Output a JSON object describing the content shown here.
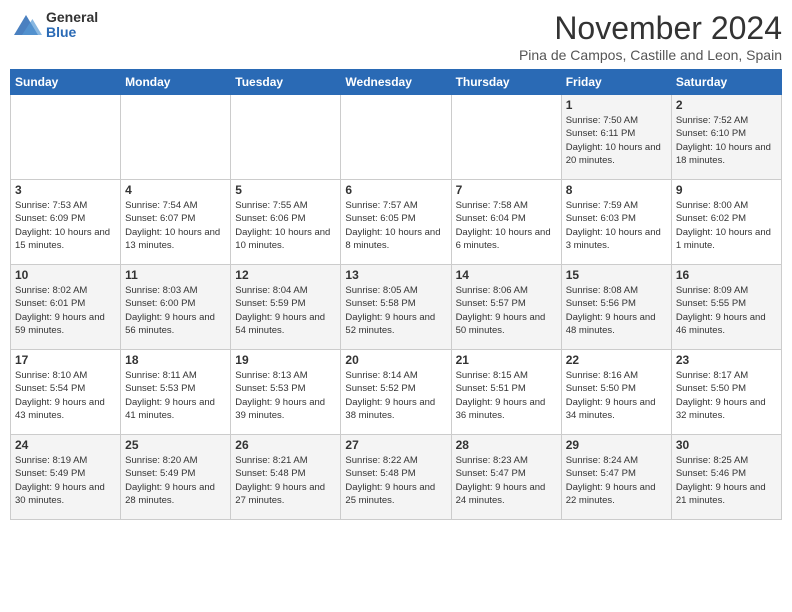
{
  "header": {
    "logo_general": "General",
    "logo_blue": "Blue",
    "month_title": "November 2024",
    "subtitle": "Pina de Campos, Castille and Leon, Spain"
  },
  "days_of_week": [
    "Sunday",
    "Monday",
    "Tuesday",
    "Wednesday",
    "Thursday",
    "Friday",
    "Saturday"
  ],
  "weeks": [
    {
      "days": [
        {
          "number": "",
          "text": ""
        },
        {
          "number": "",
          "text": ""
        },
        {
          "number": "",
          "text": ""
        },
        {
          "number": "",
          "text": ""
        },
        {
          "number": "",
          "text": ""
        },
        {
          "number": "1",
          "text": "Sunrise: 7:50 AM\nSunset: 6:11 PM\nDaylight: 10 hours and 20 minutes."
        },
        {
          "number": "2",
          "text": "Sunrise: 7:52 AM\nSunset: 6:10 PM\nDaylight: 10 hours and 18 minutes."
        }
      ]
    },
    {
      "days": [
        {
          "number": "3",
          "text": "Sunrise: 7:53 AM\nSunset: 6:09 PM\nDaylight: 10 hours and 15 minutes."
        },
        {
          "number": "4",
          "text": "Sunrise: 7:54 AM\nSunset: 6:07 PM\nDaylight: 10 hours and 13 minutes."
        },
        {
          "number": "5",
          "text": "Sunrise: 7:55 AM\nSunset: 6:06 PM\nDaylight: 10 hours and 10 minutes."
        },
        {
          "number": "6",
          "text": "Sunrise: 7:57 AM\nSunset: 6:05 PM\nDaylight: 10 hours and 8 minutes."
        },
        {
          "number": "7",
          "text": "Sunrise: 7:58 AM\nSunset: 6:04 PM\nDaylight: 10 hours and 6 minutes."
        },
        {
          "number": "8",
          "text": "Sunrise: 7:59 AM\nSunset: 6:03 PM\nDaylight: 10 hours and 3 minutes."
        },
        {
          "number": "9",
          "text": "Sunrise: 8:00 AM\nSunset: 6:02 PM\nDaylight: 10 hours and 1 minute."
        }
      ]
    },
    {
      "days": [
        {
          "number": "10",
          "text": "Sunrise: 8:02 AM\nSunset: 6:01 PM\nDaylight: 9 hours and 59 minutes."
        },
        {
          "number": "11",
          "text": "Sunrise: 8:03 AM\nSunset: 6:00 PM\nDaylight: 9 hours and 56 minutes."
        },
        {
          "number": "12",
          "text": "Sunrise: 8:04 AM\nSunset: 5:59 PM\nDaylight: 9 hours and 54 minutes."
        },
        {
          "number": "13",
          "text": "Sunrise: 8:05 AM\nSunset: 5:58 PM\nDaylight: 9 hours and 52 minutes."
        },
        {
          "number": "14",
          "text": "Sunrise: 8:06 AM\nSunset: 5:57 PM\nDaylight: 9 hours and 50 minutes."
        },
        {
          "number": "15",
          "text": "Sunrise: 8:08 AM\nSunset: 5:56 PM\nDaylight: 9 hours and 48 minutes."
        },
        {
          "number": "16",
          "text": "Sunrise: 8:09 AM\nSunset: 5:55 PM\nDaylight: 9 hours and 46 minutes."
        }
      ]
    },
    {
      "days": [
        {
          "number": "17",
          "text": "Sunrise: 8:10 AM\nSunset: 5:54 PM\nDaylight: 9 hours and 43 minutes."
        },
        {
          "number": "18",
          "text": "Sunrise: 8:11 AM\nSunset: 5:53 PM\nDaylight: 9 hours and 41 minutes."
        },
        {
          "number": "19",
          "text": "Sunrise: 8:13 AM\nSunset: 5:53 PM\nDaylight: 9 hours and 39 minutes."
        },
        {
          "number": "20",
          "text": "Sunrise: 8:14 AM\nSunset: 5:52 PM\nDaylight: 9 hours and 38 minutes."
        },
        {
          "number": "21",
          "text": "Sunrise: 8:15 AM\nSunset: 5:51 PM\nDaylight: 9 hours and 36 minutes."
        },
        {
          "number": "22",
          "text": "Sunrise: 8:16 AM\nSunset: 5:50 PM\nDaylight: 9 hours and 34 minutes."
        },
        {
          "number": "23",
          "text": "Sunrise: 8:17 AM\nSunset: 5:50 PM\nDaylight: 9 hours and 32 minutes."
        }
      ]
    },
    {
      "days": [
        {
          "number": "24",
          "text": "Sunrise: 8:19 AM\nSunset: 5:49 PM\nDaylight: 9 hours and 30 minutes."
        },
        {
          "number": "25",
          "text": "Sunrise: 8:20 AM\nSunset: 5:49 PM\nDaylight: 9 hours and 28 minutes."
        },
        {
          "number": "26",
          "text": "Sunrise: 8:21 AM\nSunset: 5:48 PM\nDaylight: 9 hours and 27 minutes."
        },
        {
          "number": "27",
          "text": "Sunrise: 8:22 AM\nSunset: 5:48 PM\nDaylight: 9 hours and 25 minutes."
        },
        {
          "number": "28",
          "text": "Sunrise: 8:23 AM\nSunset: 5:47 PM\nDaylight: 9 hours and 24 minutes."
        },
        {
          "number": "29",
          "text": "Sunrise: 8:24 AM\nSunset: 5:47 PM\nDaylight: 9 hours and 22 minutes."
        },
        {
          "number": "30",
          "text": "Sunrise: 8:25 AM\nSunset: 5:46 PM\nDaylight: 9 hours and 21 minutes."
        }
      ]
    }
  ]
}
